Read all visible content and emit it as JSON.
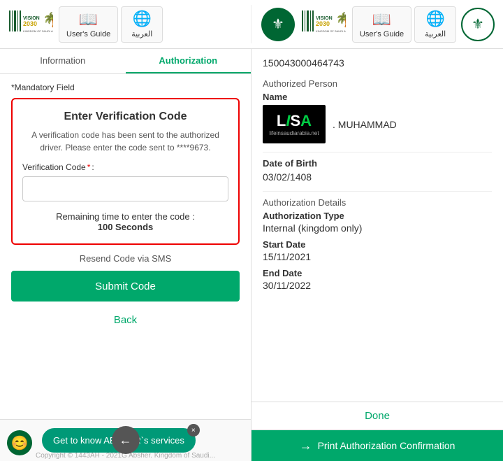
{
  "header": {
    "left": {
      "logo_alt": "Vision 2030 Logo",
      "users_guide_label": "User's Guide",
      "arabic_label": "العربية"
    },
    "right": {
      "logo_alt": "Vision 2030 Logo",
      "users_guide_label": "User's Guide",
      "arabic_label": "العربية"
    }
  },
  "left_panel": {
    "tabs": [
      {
        "label": "Information",
        "active": false
      },
      {
        "label": "Authorization",
        "active": true
      }
    ],
    "mandatory_field": "*Mandatory Field",
    "verification": {
      "title": "Enter Verification Code",
      "description": "A verification code has been sent to the authorized driver. Please enter the code sent to ****9673.",
      "code_label": "Verification Code",
      "required_star": "*",
      "colon": ":",
      "input_placeholder": "",
      "remaining_text": "Remaining time to enter the code :",
      "remaining_seconds": "100 Seconds",
      "resend_label": "Resend Code via SMS",
      "submit_label": "Submit Code",
      "back_label": "Back"
    },
    "chat_bubble": {
      "text": "Get to know ABSHER`s services",
      "close_icon": "×"
    },
    "footer_text": "Copyright © 1443AH - 2021G Absher. Kingdom of Saudi..."
  },
  "right_panel": {
    "auth_number": "150043000464743",
    "authorized_person_label": "Authorized Person",
    "name_label": "Name",
    "name_text": ". MUHAMMAD",
    "lisa_logo_text": "LISA",
    "lisa_sub_text": "lifeinsaudiarabia.net",
    "dob_label": "Date of Birth",
    "dob_value": "03/02/1408",
    "auth_details_label": "Authorization Details",
    "auth_type_label": "Authorization Type",
    "auth_type_value": "Internal (kingdom only)",
    "start_date_label": "Start Date",
    "start_date_value": "15/11/2021",
    "end_date_label": "End Date",
    "end_date_value": "30/11/2022",
    "done_label": "Done",
    "print_label": "Print Authorization Confirmation"
  }
}
